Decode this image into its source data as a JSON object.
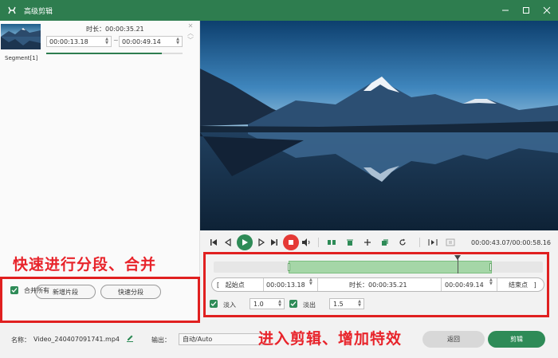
{
  "window": {
    "title": "高级剪辑"
  },
  "segment": {
    "label": "Segment[1]",
    "duration_label": "时长：00:00:35.21",
    "start_time": "00:00:13.18",
    "end_time": "00:00:49.14",
    "separator": "~",
    "progress": 0.85
  },
  "annotations": {
    "left": "快速进行分段、合并",
    "right": "进入剪辑、增加特效"
  },
  "left_actions": {
    "new_segment": "新增片段",
    "quick_split": "快速分段",
    "merge_all": "合并所有",
    "merge_all_checked": true
  },
  "playback": {
    "time_readout": "00:00:43.07/00:00:58.16"
  },
  "trim": {
    "start_label": "起始点",
    "start_time": "00:00:13.18",
    "duration_label": "时长：00:00:35.21",
    "end_time": "00:00:49.14",
    "end_label": "结束点",
    "selection_start": 0.227,
    "selection_end": 0.845,
    "playhead": 0.74
  },
  "fade": {
    "fade_in_label": "淡入",
    "fade_in_value": "1.0",
    "fade_out_label": "淡出",
    "fade_out_value": "1.5"
  },
  "footer": {
    "name_label": "名称：",
    "file_name": "Video_240407091741.mp4",
    "output_label": "输出：",
    "output_value": "自动/Auto",
    "back_label": "返回",
    "cut_label": "剪辑"
  },
  "colors": {
    "accent": "#2e8b57",
    "titlebar": "#2e7d4f",
    "stop": "#e53935",
    "annotation": "#e8242b"
  }
}
